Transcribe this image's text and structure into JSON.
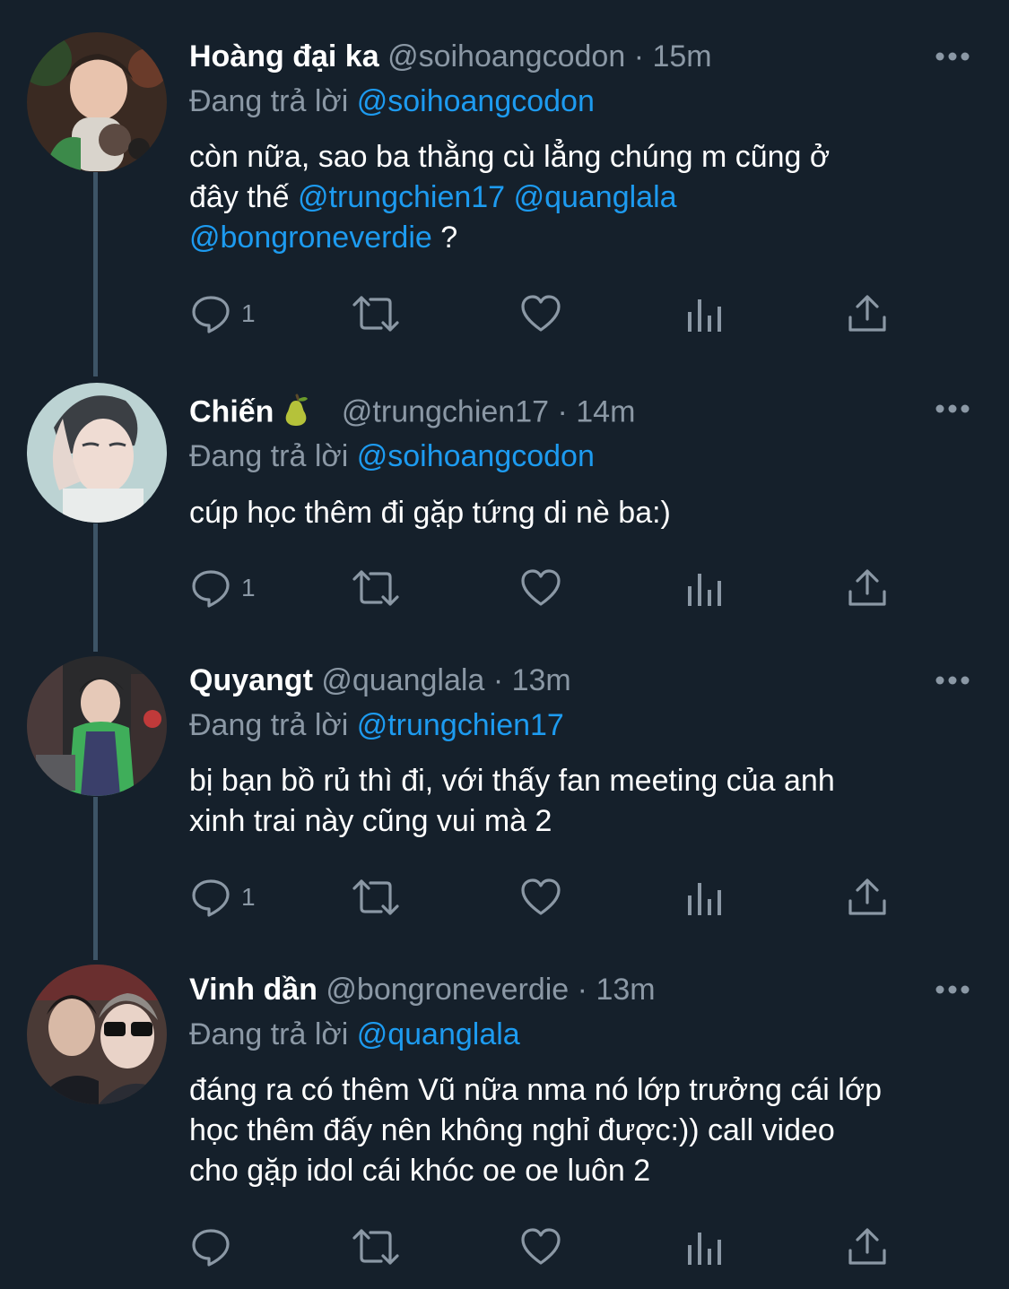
{
  "colors": {
    "background": "#15202b",
    "secondary_text": "#8b98a5",
    "mention": "#1d9bf0",
    "thread_line": "#3d5466"
  },
  "tweets": [
    {
      "name": "Hoàng đại ka",
      "handle": "@soihoangcodon",
      "dot": "·",
      "time": "15m",
      "replying_label": "Đang trả lời",
      "replying_to": "@soihoangcodon",
      "body_line1": "còn nữa, sao ba thằng cù lẳng chúng m cũng ở",
      "body_line2_text": "đây thế",
      "mention_a": "@trungchien17",
      "mention_b": "@quanglala",
      "mention_c": "@bongroneverdie",
      "body_tail": " ?",
      "reply_count": "1"
    },
    {
      "name": "Chiến",
      "name_emoji": "pear-emoji-icon",
      "handle": "@trungchien17",
      "dot": "·",
      "time": "14m",
      "replying_label": "Đang trả lời",
      "replying_to": "@soihoangcodon",
      "body": "cúp học thêm đi gặp tứng di nè ba:)",
      "reply_count": "1"
    },
    {
      "name": "Quyangt",
      "handle": "@quanglala",
      "dot": "·",
      "time": "13m",
      "replying_label": "Đang trả lời",
      "replying_to": "@trungchien17",
      "body_line1": "bị bạn bồ rủ thì đi, với thấy fan meeting của anh",
      "body_line2": "xinh trai này cũng vui mà 2",
      "reply_count": "1"
    },
    {
      "name": "Vinh dần",
      "handle": "@bongroneverdie",
      "dot": "·",
      "time": "13m",
      "replying_label": "Đang trả lời",
      "replying_to": "@quanglala",
      "body_line1": "đáng ra có thêm Vũ nữa nma nó lớp trưởng cái lớp",
      "body_line2": "học thêm đấy nên không nghỉ được:)) call video",
      "body_line3": "cho gặp idol cái khóc oe oe luôn 2",
      "reply_count": ""
    }
  ],
  "icons": {
    "reply": "reply-icon",
    "retweet": "retweet-icon",
    "like": "heart-icon",
    "views": "analytics-icon",
    "share": "share-icon",
    "more": "more-icon"
  }
}
